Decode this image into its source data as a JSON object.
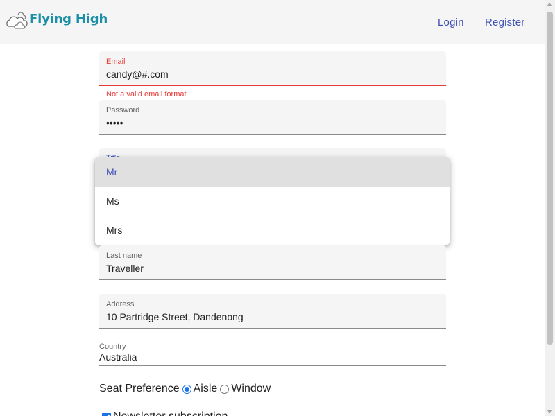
{
  "header": {
    "brand": "Flying High",
    "logo_icon": "cloud-icon",
    "nav": {
      "login": "Login",
      "register": "Register"
    }
  },
  "form": {
    "email": {
      "label": "Email",
      "value": "candy@#.com",
      "error": "Not a valid email format"
    },
    "password": {
      "label": "Password",
      "value": "•••••"
    },
    "title": {
      "label": "Title",
      "options": [
        "Mr",
        "Ms",
        "Mrs"
      ],
      "selected": "Mr"
    },
    "last_name": {
      "label": "Last name",
      "value": "Traveller"
    },
    "address": {
      "label": "Address",
      "value": "10 Partridge Street, Dandenong"
    },
    "country": {
      "label": "Country",
      "value": "Australia"
    },
    "seat": {
      "label": "Seat Preference",
      "options": [
        "Aisle",
        "Window"
      ],
      "selected": "Aisle"
    },
    "newsletter": {
      "label": "Newsletter subscription",
      "checked": true
    }
  },
  "colors": {
    "primary": "#3f51b5",
    "brand": "#1a8fa6",
    "error": "#e53935",
    "field_bg": "#f5f5f5"
  }
}
